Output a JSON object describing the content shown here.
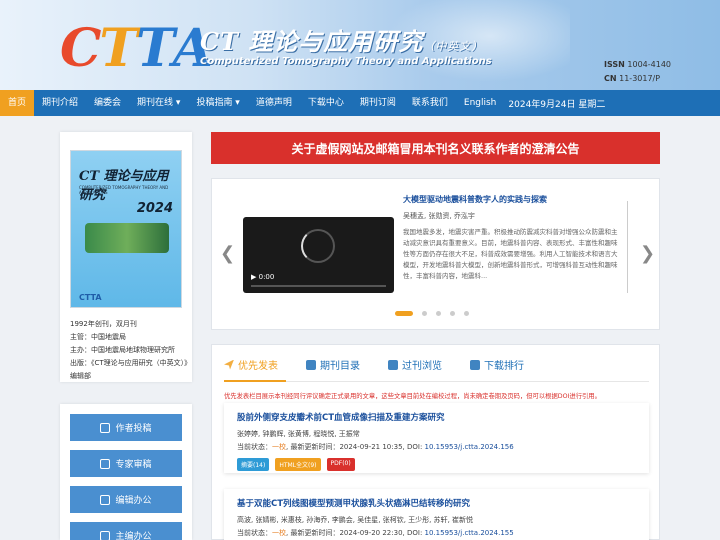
{
  "header": {
    "logo_letters": [
      "C",
      "T",
      "T",
      "A"
    ],
    "logo_colors": [
      "#e84a2c",
      "#f0a020",
      "#2a7bd0",
      "#2a7bd0"
    ],
    "title_cn": "CT 理论与应用研究",
    "title_cn_suffix": "（中英文）",
    "title_en": "Computerized Tomography Theory and Applications",
    "issn_label": "ISSN",
    "issn_value": "1004-4140",
    "cn_label": "CN",
    "cn_value": "11-3017/P"
  },
  "nav": {
    "items": [
      "首页",
      "期刊介绍",
      "编委会",
      "期刊在线 ▾",
      "投稿指南 ▾",
      "道德声明",
      "下载中心",
      "期刊订阅",
      "联系我们",
      "English"
    ],
    "date": "2024年9月24日 星期二",
    "accent": "#1e6fb6",
    "active_color": "#f0a020"
  },
  "cover": {
    "title": "CT 理论与应用研究",
    "subtitle": "COMPUTERIZED TOMOGRAPHY THEORY AND APPLICATIONS",
    "year": "2024",
    "logo": "CTTA"
  },
  "info": {
    "line1": "1992年创刊，双月刊",
    "line2": "主管：中国地震局",
    "line3": "主办：中国地震局地球物理研究所",
    "line4": "出版：《CT理论与应用研究（中英文）》编辑部"
  },
  "side_buttons": [
    "作者投稿",
    "专家审稿",
    "编辑办公",
    "主编办公"
  ],
  "notice": "关于虚假网站及邮箱冒用本刊名义联系作者的澄清公告",
  "carousel": {
    "title": "大模型驱动地震科普数字人的实践与探索",
    "authors": "吴穗孟, 张勋资, 乔泓宇",
    "abstract": "我国地震多发，地震灾害严重。积极推动防震减灾科普对增强公众防震和主动减灾意识具有重要意义。目前，地震科普内容、表现形式、丰富性和趣味性等方面仍存在很大不足，科普成效需要增强。利用人工智能技术和语言大模型，开发地震科普大模型，创新地震科普形式，可增强科普互动性和趣味性，丰富科普内容，地震科...",
    "video_time": "0:00",
    "left_arrow": "❮",
    "right_arrow": "❯",
    "slide_count": 5,
    "active_slide": 0
  },
  "tabs": {
    "items": [
      "优先发表",
      "期刊目录",
      "过刊浏览",
      "下载排行"
    ],
    "active": 0,
    "note": "优先发表栏目展示本刊经同行评议确定正式录用的文章，这些文章目前处在编校过程，尚未确定卷期及页码，但可以根据DOI进行引用。"
  },
  "articles": [
    {
      "title": "股前外侧穿支皮瓣术前CT血管成像扫描及重建方案研究",
      "authors": "张婷婷, 钟鹏辉, 张黄博, 程晓悦, 王振常",
      "status_prefix": "当前状态：",
      "status": "一校",
      "updated": ", 最新更新时间：2024-09-21 10:35, DOI: ",
      "doi": "10.15953/j.ctta.2024.156",
      "badges": [
        {
          "label": "摘要(14)",
          "color": "#2e9bd6"
        },
        {
          "label": "HTML全文(9)",
          "color": "#f0a020"
        },
        {
          "label": "PDF(0)",
          "color": "#d9302c"
        }
      ]
    },
    {
      "title": "基于双能CT列线图模型预测甲状腺乳头状癌淋巴结转移的研究",
      "authors": "高波, 张婧彬, 米惠枝, 孙海乔, 李鹏会, 吴佳星, 张柯钦, 王少彤, 苏轩, 崔新悦",
      "status_prefix": "当前状态：",
      "status": "一校",
      "updated": ", 最新更新时间：2024-09-20 22:30, DOI: ",
      "doi": "10.15953/j.ctta.2024.155",
      "badges": []
    }
  ]
}
